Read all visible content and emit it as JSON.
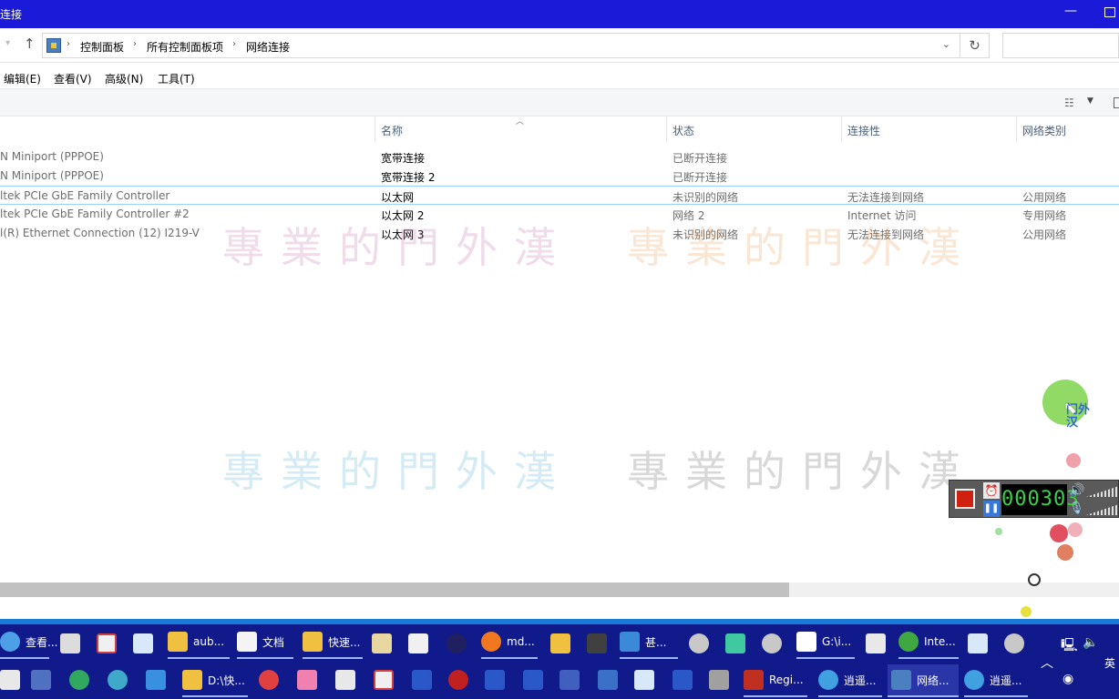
{
  "window": {
    "title": "连接"
  },
  "address": {
    "breadcrumbs": [
      "控制面板",
      "所有控制面板项",
      "网络连接"
    ]
  },
  "menu": [
    "编辑(E)",
    "查看(V)",
    "高级(N)",
    "工具(T)"
  ],
  "columns": {
    "name": "名称",
    "status": "状态",
    "connectivity": "连接性",
    "category": "网络类别"
  },
  "rows": [
    {
      "device": "N Miniport (PPPOE)",
      "name": "宽带连接",
      "status": "已断开连接",
      "connectivity": "",
      "category": ""
    },
    {
      "device": "N Miniport (PPPOE)",
      "name": "宽带连接 2",
      "status": "已断开连接",
      "connectivity": "",
      "category": ""
    },
    {
      "device": "ltek PCIe GbE Family Controller",
      "name": "以太网",
      "status": "未识别的网络",
      "connectivity": "无法连接到网络",
      "category": "公用网络"
    },
    {
      "device": "ltek PCIe GbE Family Controller #2",
      "name": "以太网 2",
      "status": "网络 2",
      "connectivity": "Internet 访问",
      "category": "专用网络"
    },
    {
      "device": "l(R) Ethernet Connection (12) I219-V",
      "name": "以太网 3",
      "status": "未识别的网络",
      "connectivity": "无法连接到网络",
      "category": "公用网络"
    }
  ],
  "selected_row": 2,
  "watermark": "專業的門外漢",
  "recorder": {
    "timer": "000303"
  },
  "cursor_tooltip": "门外汉",
  "taskbar": {
    "row1": [
      "查看...",
      "aub...",
      "文档",
      "快速...",
      "md...",
      "甚...",
      "G:\\i...",
      "Inte..."
    ],
    "row2": [
      "D:\\快...",
      "Regi...",
      "逍遥...",
      "网络...",
      "逍遥..."
    ],
    "tray": {
      "lang": "英"
    }
  },
  "colors": {
    "titlebar": "#1a1ad8",
    "taskbar": "#101a8a",
    "selection": "#99d1ff",
    "header_text": "#4c607a"
  }
}
